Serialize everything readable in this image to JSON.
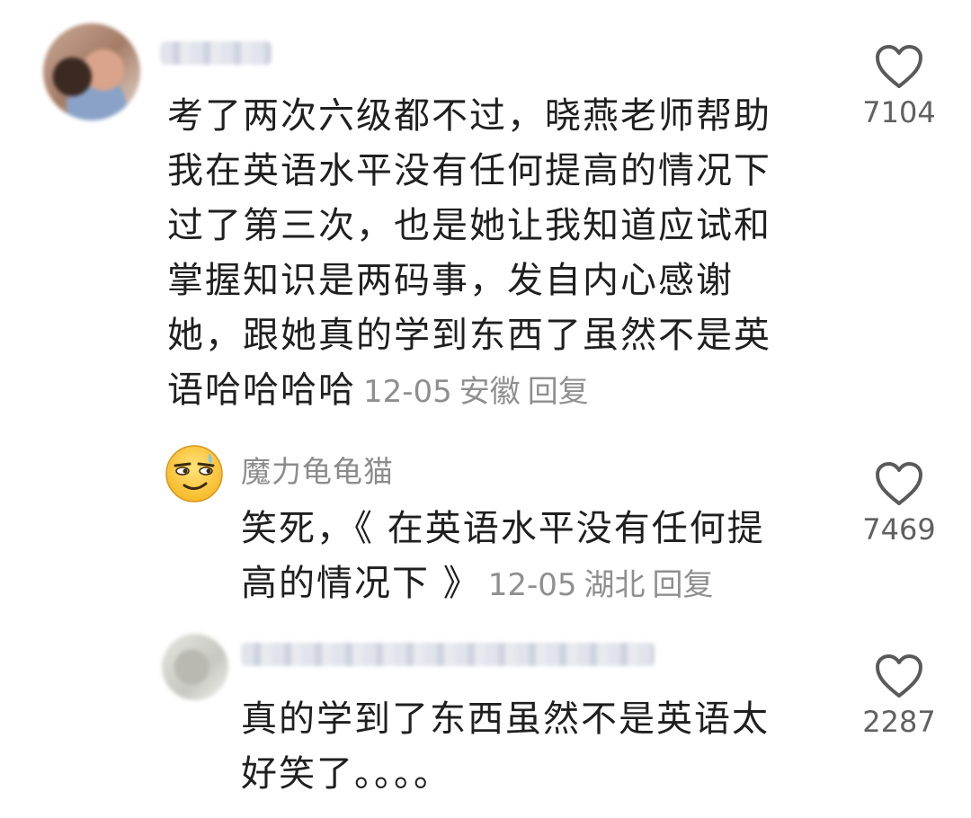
{
  "comments": [
    {
      "username": "",
      "text_lines": [
        "考了两次六级都不过，晓燕老师帮助",
        "我在英语水平没有任何提高的情况下",
        "过了第三次，也是她让我知道应试和",
        "掌握知识是两码事，发自内心感谢",
        "她，跟她真的学到东西了虽然不是英",
        "语哈哈哈哈"
      ],
      "date": "12-05",
      "location": "安徽",
      "reply_label": "回复",
      "like_icon": "heart-outline-icon",
      "like_count": "7104"
    },
    {
      "username": "魔力龟龟猫",
      "avatar_icon": "smirk-emoji-icon",
      "text_lines": [
        "笑死，《 在英语水平没有任何提",
        "高的情况下 》"
      ],
      "date": "12-05",
      "location": "湖北",
      "reply_label": "回复",
      "like_icon": "heart-outline-icon",
      "like_count": "7469"
    },
    {
      "username": "",
      "text_lines": [
        "真的学到了东西虽然不是英语太",
        "好笑了。。。。"
      ],
      "like_icon": "heart-outline-icon",
      "like_count": "2287"
    }
  ],
  "colors": {
    "text": "#1f1f1f",
    "meta": "#8f8f8f",
    "username": "#8c8c8c",
    "like_count": "#606060"
  }
}
